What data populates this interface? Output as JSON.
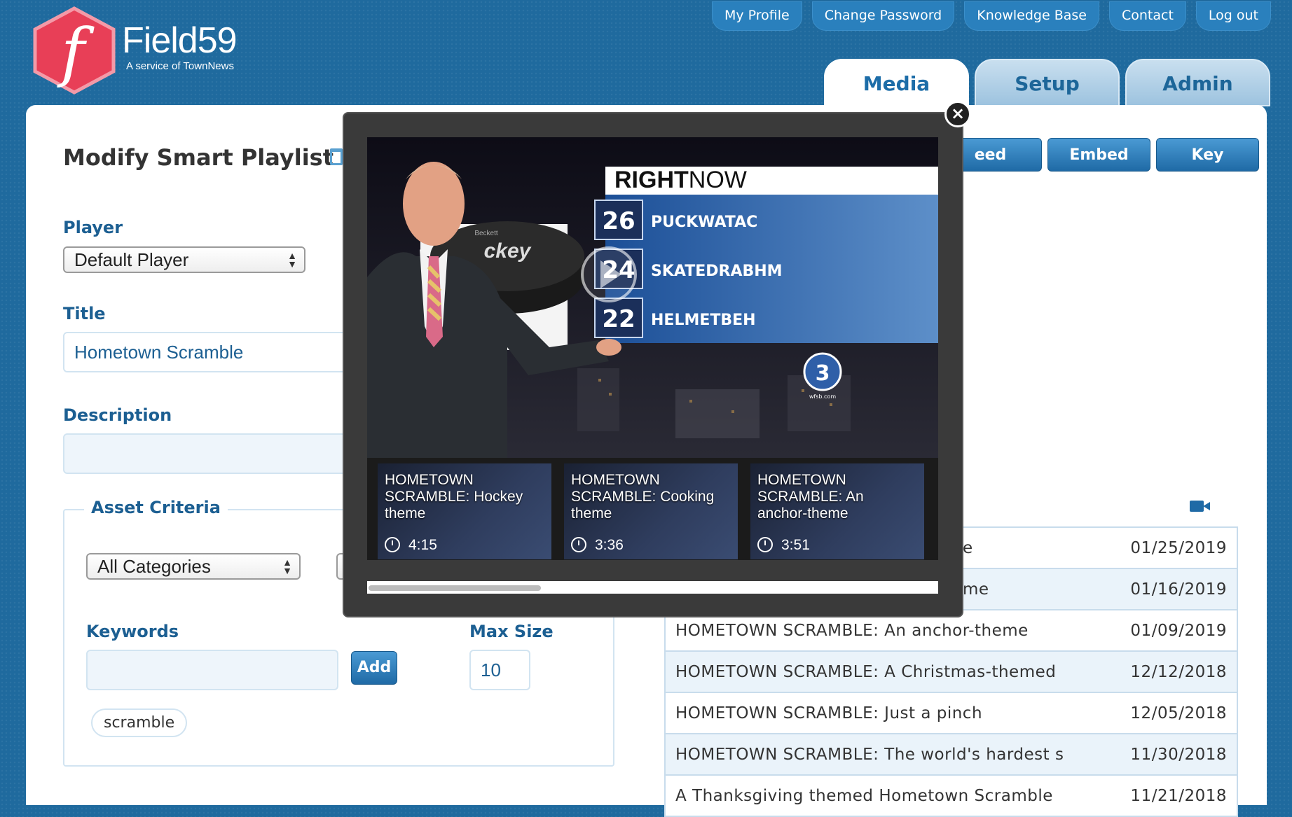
{
  "brand": {
    "name": "Field59",
    "tagline": "A service of TownNews",
    "logo_letter": "f"
  },
  "topnav": [
    "My Profile",
    "Change Password",
    "Knowledge Base",
    "Contact",
    "Log out"
  ],
  "tabs": [
    {
      "label": "Media",
      "active": true
    },
    {
      "label": "Setup",
      "active": false
    },
    {
      "label": "Admin",
      "active": false
    }
  ],
  "form": {
    "heading": "Modify Smart Playlist",
    "player_label": "Player",
    "player_value": "Default Player",
    "title_label": "Title",
    "title_value": "Hometown Scramble",
    "description_label": "Description",
    "description_value": "",
    "asset_criteria_label": "Asset Criteria",
    "category_value": "All Categories",
    "keywords_label": "Keywords",
    "keywords_value": "",
    "add_label": "Add",
    "max_size_label": "Max Size",
    "max_size_value": "10",
    "keyword_chips": [
      "scramble"
    ]
  },
  "actions": [
    "eed",
    "Embed",
    "Key"
  ],
  "table_rows": [
    {
      "title": "e",
      "date": "01/25/2019"
    },
    {
      "title": "me",
      "date": "01/16/2019"
    },
    {
      "title": "HOMETOWN SCRAMBLE: An anchor-theme",
      "date": "01/09/2019"
    },
    {
      "title": "HOMETOWN SCRAMBLE: A Christmas-themed",
      "date": "12/12/2018"
    },
    {
      "title": "HOMETOWN SCRAMBLE: Just a pinch",
      "date": "12/05/2018"
    },
    {
      "title": "HOMETOWN SCRAMBLE: The world's hardest s",
      "date": "11/30/2018"
    },
    {
      "title": "A Thanksgiving themed Hometown Scramble",
      "date": "11/21/2018"
    }
  ],
  "modal": {
    "video": {
      "banner": "RIGHTNOW",
      "banner_bold": "RIGHT",
      "banner_light": "NOW",
      "rows": [
        {
          "num": "26",
          "word": "PUCKWATAC"
        },
        {
          "num": "24",
          "word": "SKATEDRABHM"
        },
        {
          "num": "22",
          "word": "HELMETBEH"
        }
      ],
      "puck_text": "ckey",
      "puck_small": "Beckett",
      "station_badge": "3",
      "station_url": "wfsb.com"
    },
    "thumbnails": [
      {
        "title": "HOMETOWN SCRAMBLE: Hockey theme",
        "duration": "4:15"
      },
      {
        "title": "HOMETOWN SCRAMBLE: Cooking theme",
        "duration": "3:36"
      },
      {
        "title": "HOMETOWN SCRAMBLE: An anchor-theme",
        "duration": "3:51"
      }
    ],
    "close_glyph": "×"
  },
  "colors": {
    "brand_blue": "#1f6a9e",
    "logo_red": "#e33a52",
    "accent": "#1c5f92"
  }
}
